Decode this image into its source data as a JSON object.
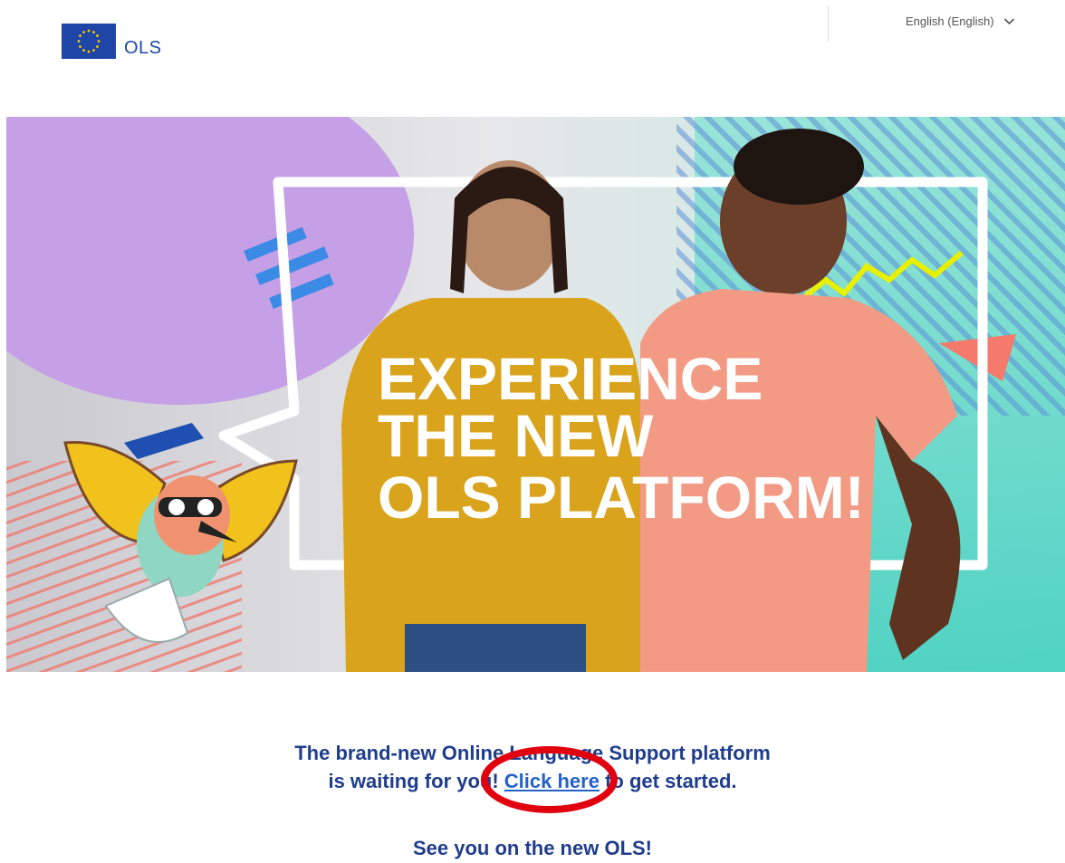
{
  "header": {
    "logo_text": "OLS",
    "language": {
      "selected": "English (English)"
    }
  },
  "hero": {
    "headline": [
      "EXPERIENCE",
      "THE NEW",
      "OLS PLATFORM!"
    ]
  },
  "message": {
    "line1": "The brand-new Online Language Support platform",
    "line2_before": "is waiting for you! ",
    "link_text": "Click here",
    "line2_after": " to get started.",
    "farewell": "See you on the new OLS!"
  },
  "colors": {
    "brand_blue": "#1f46a7",
    "text_navy": "#1f3d8c",
    "link_blue": "#2461c9",
    "highlight_red": "#e0000e",
    "eu_star_yellow": "#ffcc00"
  }
}
